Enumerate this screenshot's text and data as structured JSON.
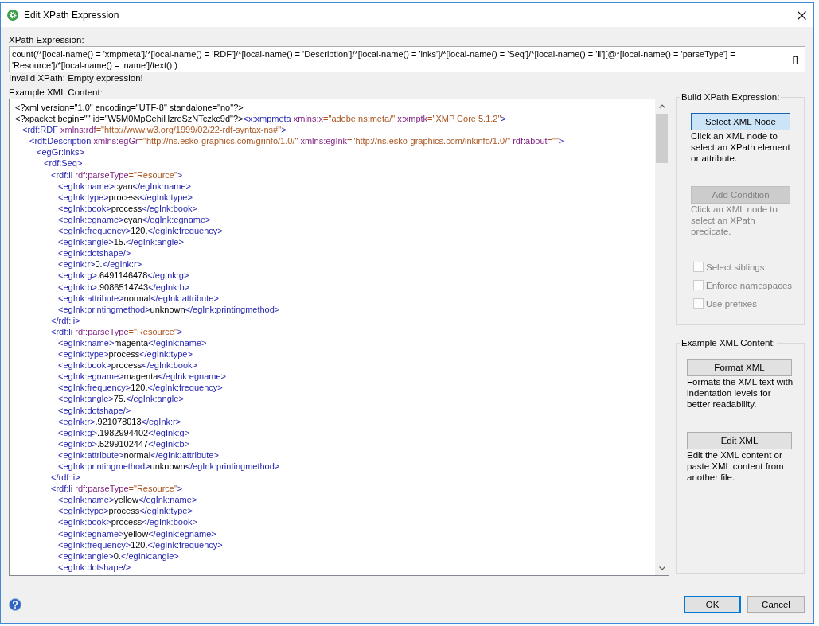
{
  "window": {
    "title": "Edit XPath Expression"
  },
  "xpath": {
    "label": "XPath Expression:",
    "value": "count(/*[local-name() = 'xmpmeta']/*[local-name() = 'RDF']/*[local-name() = 'Description']/*[local-name() = 'inks']/*[local-name() = 'Seq']/*[local-name() = 'li'][@*[local-name() = 'parseType'] = 'Resource']/*[local-name() = 'name']/text() )",
    "button": "[]",
    "message": "Invalid XPath: Empty expression!"
  },
  "xml_content": {
    "label": "Example XML Content:",
    "lines": [
      {
        "tokens": [
          {
            "kind": "pi",
            "text": "<?xml version=\"1.0\" encoding=\"UTF-8\" standalone=\"no\"?>"
          }
        ]
      },
      {
        "tokens": [
          {
            "kind": "pi",
            "text": "<?xpacket begin=\"\" id=\"W5M0MpCehiHzreSzNTczkc9d\"?>"
          },
          {
            "kind": "tag",
            "text": "<x:xmpmeta"
          },
          {
            "kind": "attr",
            "text": " xmlns:x"
          },
          {
            "kind": "value",
            "text": "=\"adobe:ns:meta/\""
          },
          {
            "kind": "attr",
            "text": " x:xmptk"
          },
          {
            "kind": "value",
            "text": "=\"XMP Core 5.1.2\""
          },
          {
            "kind": "tag",
            "text": ">"
          }
        ],
        "children": [
          {
            "tokens": [
              {
                "kind": "tag",
                "text": "<rdf:RDF"
              },
              {
                "kind": "attr",
                "text": " xmlns:rdf"
              },
              {
                "kind": "value",
                "text": "=\"http://www.w3.org/1999/02/22-rdf-syntax-ns#\""
              },
              {
                "kind": "tag",
                "text": ">"
              }
            ],
            "children": [
              {
                "tokens": [
                  {
                    "kind": "tag",
                    "text": "<rdf:Description"
                  },
                  {
                    "kind": "attr",
                    "text": " xmlns:egGr"
                  },
                  {
                    "kind": "value",
                    "text": "=\"http://ns.esko-graphics.com/grinfo/1.0/\""
                  },
                  {
                    "kind": "attr",
                    "text": " xmlns:egInk"
                  },
                  {
                    "kind": "value",
                    "text": "=\"http://ns.esko-graphics.com/inkinfo/1.0/\""
                  },
                  {
                    "kind": "attr",
                    "text": " rdf:about"
                  },
                  {
                    "kind": "value",
                    "text": "=\"\""
                  },
                  {
                    "kind": "tag",
                    "text": ">"
                  }
                ],
                "children": [
                  {
                    "tokens": [
                      {
                        "kind": "tag",
                        "text": "<egGr:inks>"
                      }
                    ],
                    "children": [
                      {
                        "tokens": [
                          {
                            "kind": "tag",
                            "text": "<rdf:Seq>"
                          }
                        ],
                        "children": [
                          {
                            "tokens": [
                              {
                                "kind": "tag",
                                "text": "<rdf:li"
                              },
                              {
                                "kind": "attr",
                                "text": " rdf:parseType"
                              },
                              {
                                "kind": "value",
                                "text": "=\"Resource\""
                              },
                              {
                                "kind": "tag",
                                "text": ">"
                              }
                            ],
                            "children": [
                              {
                                "tokens": [
                                  {
                                    "kind": "tag",
                                    "text": "<egInk:name>"
                                  },
                                  {
                                    "kind": "text",
                                    "text": "cyan"
                                  },
                                  {
                                    "kind": "tag",
                                    "text": "</egInk:name>"
                                  }
                                ]
                              },
                              {
                                "tokens": [
                                  {
                                    "kind": "tag",
                                    "text": "<egInk:type>"
                                  },
                                  {
                                    "kind": "text",
                                    "text": "process"
                                  },
                                  {
                                    "kind": "tag",
                                    "text": "</egInk:type>"
                                  }
                                ]
                              },
                              {
                                "tokens": [
                                  {
                                    "kind": "tag",
                                    "text": "<egInk:book>"
                                  },
                                  {
                                    "kind": "text",
                                    "text": "process"
                                  },
                                  {
                                    "kind": "tag",
                                    "text": "</egInk:book>"
                                  }
                                ]
                              },
                              {
                                "tokens": [
                                  {
                                    "kind": "tag",
                                    "text": "<egInk:egname>"
                                  },
                                  {
                                    "kind": "text",
                                    "text": "cyan"
                                  },
                                  {
                                    "kind": "tag",
                                    "text": "</egInk:egname>"
                                  }
                                ]
                              },
                              {
                                "tokens": [
                                  {
                                    "kind": "tag",
                                    "text": "<egInk:frequency>"
                                  },
                                  {
                                    "kind": "text",
                                    "text": "120."
                                  },
                                  {
                                    "kind": "tag",
                                    "text": "</egInk:frequency>"
                                  }
                                ]
                              },
                              {
                                "tokens": [
                                  {
                                    "kind": "tag",
                                    "text": "<egInk:angle>"
                                  },
                                  {
                                    "kind": "text",
                                    "text": "15."
                                  },
                                  {
                                    "kind": "tag",
                                    "text": "</egInk:angle>"
                                  }
                                ]
                              },
                              {
                                "tokens": [
                                  {
                                    "kind": "tag",
                                    "text": "<egInk:dotshape/>"
                                  }
                                ]
                              },
                              {
                                "tokens": [
                                  {
                                    "kind": "tag",
                                    "text": "<egInk:r>"
                                  },
                                  {
                                    "kind": "text",
                                    "text": "0."
                                  },
                                  {
                                    "kind": "tag",
                                    "text": "</egInk:r>"
                                  }
                                ]
                              },
                              {
                                "tokens": [
                                  {
                                    "kind": "tag",
                                    "text": "<egInk:g>"
                                  },
                                  {
                                    "kind": "text",
                                    "text": ".6491146478"
                                  },
                                  {
                                    "kind": "tag",
                                    "text": "</egInk:g>"
                                  }
                                ]
                              },
                              {
                                "tokens": [
                                  {
                                    "kind": "tag",
                                    "text": "<egInk:b>"
                                  },
                                  {
                                    "kind": "text",
                                    "text": ".9086514743"
                                  },
                                  {
                                    "kind": "tag",
                                    "text": "</egInk:b>"
                                  }
                                ]
                              },
                              {
                                "tokens": [
                                  {
                                    "kind": "tag",
                                    "text": "<egInk:attribute>"
                                  },
                                  {
                                    "kind": "text",
                                    "text": "normal"
                                  },
                                  {
                                    "kind": "tag",
                                    "text": "</egInk:attribute>"
                                  }
                                ]
                              },
                              {
                                "tokens": [
                                  {
                                    "kind": "tag",
                                    "text": "<egInk:printingmethod>"
                                  },
                                  {
                                    "kind": "text",
                                    "text": "unknown"
                                  },
                                  {
                                    "kind": "tag",
                                    "text": "</egInk:printingmethod>"
                                  }
                                ]
                              }
                            ]
                          },
                          {
                            "tokens": [
                              {
                                "kind": "tag",
                                "text": "</rdf:li>"
                              }
                            ]
                          },
                          {
                            "tokens": [
                              {
                                "kind": "tag",
                                "text": "<rdf:li"
                              },
                              {
                                "kind": "attr",
                                "text": " rdf:parseType"
                              },
                              {
                                "kind": "value",
                                "text": "=\"Resource\""
                              },
                              {
                                "kind": "tag",
                                "text": ">"
                              }
                            ],
                            "children": [
                              {
                                "tokens": [
                                  {
                                    "kind": "tag",
                                    "text": "<egInk:name>"
                                  },
                                  {
                                    "kind": "text",
                                    "text": "magenta"
                                  },
                                  {
                                    "kind": "tag",
                                    "text": "</egInk:name>"
                                  }
                                ]
                              },
                              {
                                "tokens": [
                                  {
                                    "kind": "tag",
                                    "text": "<egInk:type>"
                                  },
                                  {
                                    "kind": "text",
                                    "text": "process"
                                  },
                                  {
                                    "kind": "tag",
                                    "text": "</egInk:type>"
                                  }
                                ]
                              },
                              {
                                "tokens": [
                                  {
                                    "kind": "tag",
                                    "text": "<egInk:book>"
                                  },
                                  {
                                    "kind": "text",
                                    "text": "process"
                                  },
                                  {
                                    "kind": "tag",
                                    "text": "</egInk:book>"
                                  }
                                ]
                              },
                              {
                                "tokens": [
                                  {
                                    "kind": "tag",
                                    "text": "<egInk:egname>"
                                  },
                                  {
                                    "kind": "text",
                                    "text": "magenta"
                                  },
                                  {
                                    "kind": "tag",
                                    "text": "</egInk:egname>"
                                  }
                                ]
                              },
                              {
                                "tokens": [
                                  {
                                    "kind": "tag",
                                    "text": "<egInk:frequency>"
                                  },
                                  {
                                    "kind": "text",
                                    "text": "120."
                                  },
                                  {
                                    "kind": "tag",
                                    "text": "</egInk:frequency>"
                                  }
                                ]
                              },
                              {
                                "tokens": [
                                  {
                                    "kind": "tag",
                                    "text": "<egInk:angle>"
                                  },
                                  {
                                    "kind": "text",
                                    "text": "75."
                                  },
                                  {
                                    "kind": "tag",
                                    "text": "</egInk:angle>"
                                  }
                                ]
                              },
                              {
                                "tokens": [
                                  {
                                    "kind": "tag",
                                    "text": "<egInk:dotshape/>"
                                  }
                                ]
                              },
                              {
                                "tokens": [
                                  {
                                    "kind": "tag",
                                    "text": "<egInk:r>"
                                  },
                                  {
                                    "kind": "text",
                                    "text": ".921078013"
                                  },
                                  {
                                    "kind": "tag",
                                    "text": "</egInk:r>"
                                  }
                                ]
                              },
                              {
                                "tokens": [
                                  {
                                    "kind": "tag",
                                    "text": "<egInk:g>"
                                  },
                                  {
                                    "kind": "text",
                                    "text": ".1982994402"
                                  },
                                  {
                                    "kind": "tag",
                                    "text": "</egInk:g>"
                                  }
                                ]
                              },
                              {
                                "tokens": [
                                  {
                                    "kind": "tag",
                                    "text": "<egInk:b>"
                                  },
                                  {
                                    "kind": "text",
                                    "text": ".5299102447"
                                  },
                                  {
                                    "kind": "tag",
                                    "text": "</egInk:b>"
                                  }
                                ]
                              },
                              {
                                "tokens": [
                                  {
                                    "kind": "tag",
                                    "text": "<egInk:attribute>"
                                  },
                                  {
                                    "kind": "text",
                                    "text": "normal"
                                  },
                                  {
                                    "kind": "tag",
                                    "text": "</egInk:attribute>"
                                  }
                                ]
                              },
                              {
                                "tokens": [
                                  {
                                    "kind": "tag",
                                    "text": "<egInk:printingmethod>"
                                  },
                                  {
                                    "kind": "text",
                                    "text": "unknown"
                                  },
                                  {
                                    "kind": "tag",
                                    "text": "</egInk:printingmethod>"
                                  }
                                ]
                              }
                            ]
                          },
                          {
                            "tokens": [
                              {
                                "kind": "tag",
                                "text": "</rdf:li>"
                              }
                            ]
                          },
                          {
                            "tokens": [
                              {
                                "kind": "tag",
                                "text": "<rdf:li"
                              },
                              {
                                "kind": "attr",
                                "text": " rdf:parseType"
                              },
                              {
                                "kind": "value",
                                "text": "=\"Resource\""
                              },
                              {
                                "kind": "tag",
                                "text": ">"
                              }
                            ],
                            "children": [
                              {
                                "tokens": [
                                  {
                                    "kind": "tag",
                                    "text": "<egInk:name>"
                                  },
                                  {
                                    "kind": "text",
                                    "text": "yellow"
                                  },
                                  {
                                    "kind": "tag",
                                    "text": "</egInk:name>"
                                  }
                                ]
                              },
                              {
                                "tokens": [
                                  {
                                    "kind": "tag",
                                    "text": "<egInk:type>"
                                  },
                                  {
                                    "kind": "text",
                                    "text": "process"
                                  },
                                  {
                                    "kind": "tag",
                                    "text": "</egInk:type>"
                                  }
                                ]
                              },
                              {
                                "tokens": [
                                  {
                                    "kind": "tag",
                                    "text": "<egInk:book>"
                                  },
                                  {
                                    "kind": "text",
                                    "text": "process"
                                  },
                                  {
                                    "kind": "tag",
                                    "text": "</egInk:book>"
                                  }
                                ]
                              },
                              {
                                "tokens": [
                                  {
                                    "kind": "tag",
                                    "text": "<egInk:egname>"
                                  },
                                  {
                                    "kind": "text",
                                    "text": "yellow"
                                  },
                                  {
                                    "kind": "tag",
                                    "text": "</egInk:egname>"
                                  }
                                ]
                              },
                              {
                                "tokens": [
                                  {
                                    "kind": "tag",
                                    "text": "<egInk:frequency>"
                                  },
                                  {
                                    "kind": "text",
                                    "text": "120."
                                  },
                                  {
                                    "kind": "tag",
                                    "text": "</egInk:frequency>"
                                  }
                                ]
                              },
                              {
                                "tokens": [
                                  {
                                    "kind": "tag",
                                    "text": "<egInk:angle>"
                                  },
                                  {
                                    "kind": "text",
                                    "text": "0."
                                  },
                                  {
                                    "kind": "tag",
                                    "text": "</egInk:angle>"
                                  }
                                ]
                              },
                              {
                                "tokens": [
                                  {
                                    "kind": "tag",
                                    "text": "<egInk:dotshape/>"
                                  }
                                ]
                              }
                            ]
                          }
                        ]
                      }
                    ]
                  }
                ]
              }
            ]
          }
        ]
      }
    ]
  },
  "build_panel": {
    "title": "Build XPath Expression:",
    "actions": [
      {
        "label": "Select XML Node",
        "pressed": true,
        "disabled": false,
        "description": "Click an XML node to select an XPath element or attribute."
      },
      {
        "label": "Add Condition",
        "pressed": false,
        "disabled": true,
        "description": "Click an XML node to select an XPath predicate."
      }
    ],
    "options": [
      {
        "label": "Select siblings",
        "checked": false,
        "disabled": true
      },
      {
        "label": "Enforce namespaces",
        "checked": false,
        "disabled": true
      },
      {
        "label": "Use prefixes",
        "checked": false,
        "disabled": true
      }
    ]
  },
  "xml_panel": {
    "title": "Example XML Content:",
    "actions": [
      {
        "label": "Format XML",
        "pressed": false,
        "disabled": false,
        "description": "Formats the XML text with indentation levels for better readability."
      },
      {
        "label": "Edit XML",
        "pressed": false,
        "disabled": false,
        "description": "Edit the XML content or paste XML content from another file."
      }
    ]
  },
  "footer": {
    "buttons": [
      {
        "label": "OK",
        "default": true
      },
      {
        "label": "Cancel",
        "default": false
      }
    ]
  }
}
